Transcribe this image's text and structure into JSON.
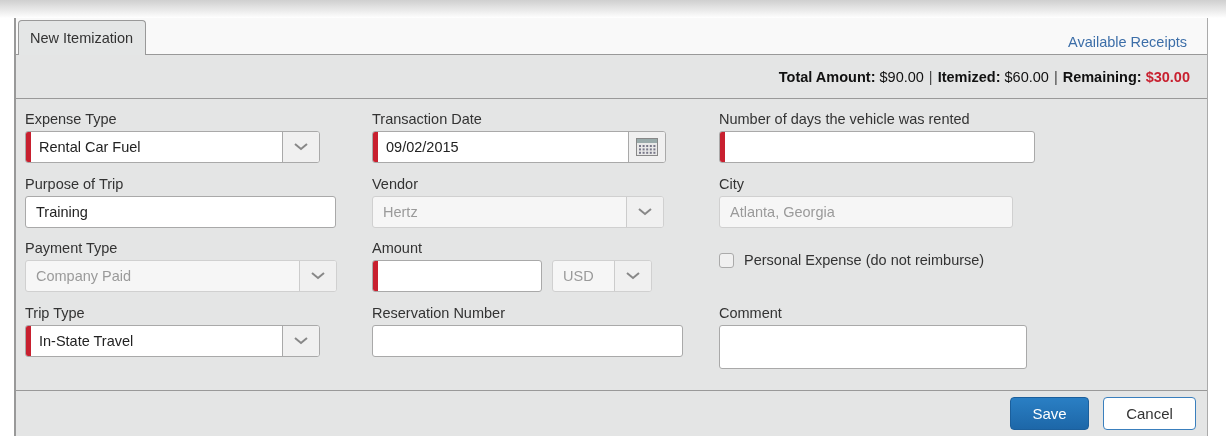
{
  "tab": {
    "label": "New Itemization",
    "selected": true
  },
  "available_receipts_link": "Available Receipts",
  "summary": {
    "items": [
      {
        "label": "Total Amount:",
        "value": "$90.00",
        "alert": false
      },
      {
        "label": "Itemized:",
        "value": "$60.00",
        "alert": false
      },
      {
        "label": "Remaining:",
        "value": "$30.00",
        "alert": true
      }
    ],
    "separators": [
      "|",
      "|"
    ]
  },
  "rows": [
    [
      {
        "kind": "select",
        "label": "Expense Type",
        "value": "Rental Car Fuel",
        "required": true,
        "disabled": false
      },
      {
        "kind": "date",
        "label": "Transaction Date",
        "value": "09/02/2015",
        "required": true,
        "disabled": false
      },
      {
        "kind": "text",
        "label": "Number of days the vehicle was rented",
        "required": true,
        "disabled": false
      }
    ],
    [
      {
        "kind": "text",
        "label": "Purpose of Trip",
        "value": "Training",
        "required": false,
        "disabled": false
      },
      {
        "kind": "select",
        "label": "Vendor",
        "value": "Hertz",
        "required": false,
        "disabled": true
      },
      {
        "kind": "text",
        "label": "City",
        "value": "Atlanta, Georgia",
        "required": false,
        "disabled": true
      }
    ],
    [
      {
        "kind": "select",
        "label": "Payment Type",
        "value": "Company Paid",
        "required": false,
        "disabled": true
      },
      {
        "kind": "amount",
        "label": "Amount",
        "required": true,
        "disabled": false,
        "currency": {
          "value": "USD",
          "disabled": true
        }
      },
      {
        "kind": "checkbox",
        "label": "Personal Expense (do not reimburse)",
        "checked": false
      }
    ],
    [
      {
        "kind": "select",
        "label": "Trip Type",
        "value": "In-State Travel",
        "required": true,
        "disabled": false
      },
      {
        "kind": "text",
        "label": "Reservation Number",
        "required": false,
        "disabled": false
      },
      {
        "kind": "textarea",
        "label": "Comment",
        "required": false,
        "disabled": false
      }
    ]
  ],
  "buttons": [
    {
      "label": "Save",
      "kind": "primary"
    },
    {
      "label": "Cancel",
      "kind": "secondary"
    }
  ]
}
